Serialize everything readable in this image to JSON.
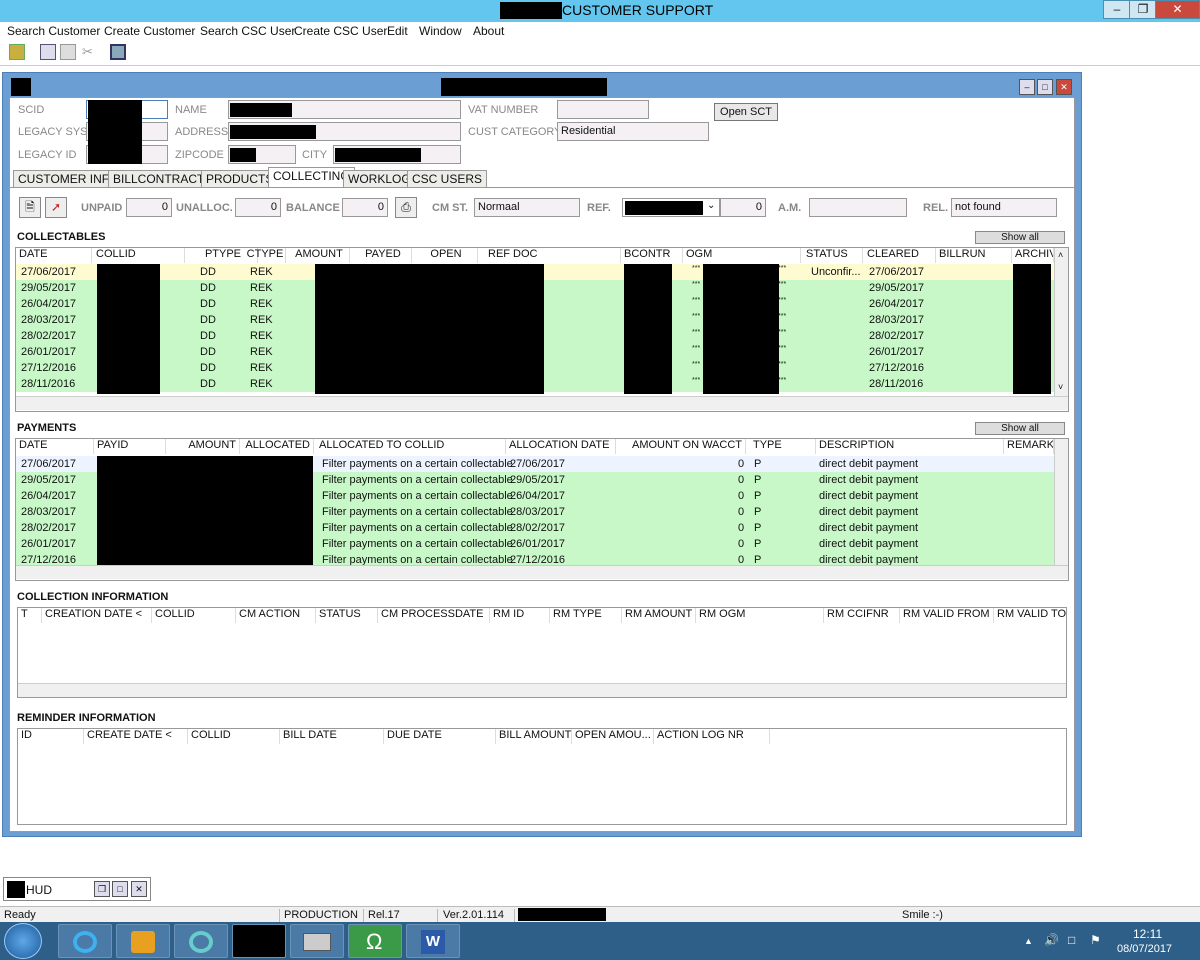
{
  "window": {
    "title": "CUSTOMER SUPPORT"
  },
  "menu": [
    "Search Customer",
    "Create Customer",
    "Search CSC User",
    "Create CSC User",
    "Edit",
    "Window",
    "About"
  ],
  "customer": {
    "labels": {
      "scid": "SCID",
      "legacy_sys": "LEGACY SYS",
      "legacy_id": "LEGACY ID",
      "name": "NAME",
      "address": "ADDRESS",
      "zipcode": "ZIPCODE",
      "city": "CITY",
      "vat": "VAT NUMBER",
      "cust_category": "CUST CATEGORY"
    },
    "cust_category": "Residential",
    "open_sct": "Open SCT"
  },
  "tabs": [
    "CUSTOMER INFO",
    "BILLCONTRACTS",
    "PRODUCTS",
    "COLLECTING",
    "WORKLOG",
    "CSC USERS"
  ],
  "active_tab": "COLLECTING",
  "summary": {
    "unpaid_label": "UNPAID",
    "unpaid": "0",
    "unalloc_label": "UNALLOC.",
    "unalloc": "0",
    "balance_label": "BALANCE",
    "balance": "0",
    "cmst_label": "CM ST.",
    "cmst": "Normaal",
    "ref_label": "REF.",
    "ref_value": "0",
    "am_label": "A.M.",
    "rel_label": "REL.",
    "rel": "not found"
  },
  "collectables": {
    "title": "COLLECTABLES",
    "show_all": "Show all",
    "columns": [
      "DATE",
      "COLLID",
      "PTYPE",
      "CTYPE",
      "AMOUNT",
      "PAYED",
      "OPEN",
      "REF DOC",
      "BCONTR",
      "OGM",
      "STATUS",
      "CLEARED",
      "BILLRUN",
      "ARCHIV"
    ],
    "rows": [
      {
        "date": "27/06/2017",
        "ptype": "DD",
        "ctype": "REK",
        "status": "Unconfir...",
        "cleared": "27/06/2017"
      },
      {
        "date": "29/05/2017",
        "ptype": "DD",
        "ctype": "REK",
        "status": "",
        "cleared": "29/05/2017"
      },
      {
        "date": "26/04/2017",
        "ptype": "DD",
        "ctype": "REK",
        "status": "",
        "cleared": "26/04/2017"
      },
      {
        "date": "28/03/2017",
        "ptype": "DD",
        "ctype": "REK",
        "status": "",
        "cleared": "28/03/2017"
      },
      {
        "date": "28/02/2017",
        "ptype": "DD",
        "ctype": "REK",
        "status": "",
        "cleared": "28/02/2017"
      },
      {
        "date": "26/01/2017",
        "ptype": "DD",
        "ctype": "REK",
        "status": "",
        "cleared": "26/01/2017"
      },
      {
        "date": "27/12/2016",
        "ptype": "DD",
        "ctype": "REK",
        "status": "",
        "cleared": "27/12/2016"
      },
      {
        "date": "28/11/2016",
        "ptype": "DD",
        "ctype": "REK",
        "status": "",
        "cleared": "28/11/2016"
      }
    ],
    "ogm_marks": "***"
  },
  "payments": {
    "title": "PAYMENTS",
    "show_all": "Show all",
    "columns": [
      "DATE",
      "PAYID",
      "AMOUNT",
      "ALLOCATED",
      "ALLOCATED TO COLLID",
      "ALLOCATION DATE",
      "AMOUNT ON WACCT",
      "TYPE",
      "DESCRIPTION",
      "REMARK"
    ],
    "rows": [
      {
        "date": "27/06/2017",
        "alloc_to": "Filter payments on a certain collectable",
        "alloc_date": "27/06/2017",
        "wacct": "0",
        "type": "P",
        "desc": "direct debit payment"
      },
      {
        "date": "29/05/2017",
        "alloc_to": "Filter payments on a certain collectable",
        "alloc_date": "29/05/2017",
        "wacct": "0",
        "type": "P",
        "desc": "direct debit payment"
      },
      {
        "date": "26/04/2017",
        "alloc_to": "Filter payments on a certain collectable",
        "alloc_date": "26/04/2017",
        "wacct": "0",
        "type": "P",
        "desc": "direct debit payment"
      },
      {
        "date": "28/03/2017",
        "alloc_to": "Filter payments on a certain collectable",
        "alloc_date": "28/03/2017",
        "wacct": "0",
        "type": "P",
        "desc": "direct debit payment"
      },
      {
        "date": "28/02/2017",
        "alloc_to": "Filter payments on a certain collectable",
        "alloc_date": "28/02/2017",
        "wacct": "0",
        "type": "P",
        "desc": "direct debit payment"
      },
      {
        "date": "26/01/2017",
        "alloc_to": "Filter payments on a certain collectable",
        "alloc_date": "26/01/2017",
        "wacct": "0",
        "type": "P",
        "desc": "direct debit payment"
      },
      {
        "date": "27/12/2016",
        "alloc_to": "Filter payments on a certain collectable",
        "alloc_date": "27/12/2016",
        "wacct": "0",
        "type": "P",
        "desc": "direct debit payment"
      }
    ]
  },
  "collection_info": {
    "title": "COLLECTION INFORMATION",
    "columns": [
      "T",
      "CREATION DATE <",
      "COLLID",
      "CM ACTION",
      "STATUS",
      "CM PROCESSDATE",
      "RM ID",
      "RM TYPE",
      "RM AMOUNT",
      "RM OGM",
      "RM CCIFNR",
      "RM VALID FROM",
      "RM VALID TO"
    ]
  },
  "reminder_info": {
    "title": "REMINDER INFORMATION",
    "columns": [
      "ID",
      "CREATE DATE <",
      "COLLID",
      "BILL DATE",
      "DUE DATE",
      "BILL AMOUNT",
      "OPEN AMOU...",
      "ACTION LOG NR"
    ]
  },
  "hud": {
    "label": "HUD"
  },
  "status": {
    "ready": "Ready",
    "env": "PRODUCTION",
    "rel": "Rel.17",
    "ver": "Ver.2.01.114",
    "smile": "Smile :-)"
  },
  "clock": {
    "time": "12:11",
    "date": "08/07/2017"
  },
  "colors": {
    "titlebar": "#63c6ef",
    "row_green": "#c8f8c8",
    "row_selected": "#fffbd0",
    "taskbar": "#2e5f88"
  }
}
